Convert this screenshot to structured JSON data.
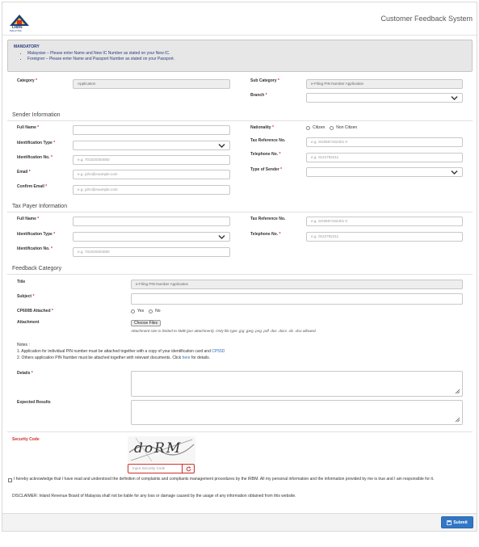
{
  "header": {
    "title": "Customer Feedback System",
    "logo_text": "LHDN",
    "logo_subtext": "MALAYSIA"
  },
  "mandatory": {
    "title": "MANDATORY",
    "items": [
      "Malaysian – Please enter Name and New IC Number as stated on your New IC.",
      "Foreigner – Please enter Name and Passport Number as stated on your Passport."
    ]
  },
  "top": {
    "category_label": "Category",
    "category_value": "Application",
    "subcategory_label": "Sub Category",
    "subcategory_value": "e-Filing PIN Number Application",
    "branch_label": "Branch"
  },
  "sender": {
    "section_title": "Sender Information",
    "full_name_label": "Full Name",
    "id_type_label": "Identification Type",
    "id_no_label": "Identification No.",
    "id_no_placeholder": "e.g. 701020304050",
    "email_label": "Email",
    "email_placeholder": "e.g. john@example.com",
    "confirm_email_label": "Confirm Email",
    "confirm_email_placeholder": "e.g. john@example.com",
    "nationality_label": "Nationality",
    "nationality_options": [
      "Citizen",
      "Non Citizen"
    ],
    "tax_ref_label": "Tax Reference No.",
    "tax_ref_placeholder": "e.g. SG0567162401 0",
    "telephone_label": "Telephone No.",
    "telephone_placeholder": "e.g. 0122782211",
    "sender_type_label": "Type of Sender"
  },
  "taxpayer": {
    "section_title": "Tax Payer Information",
    "full_name_label": "Full Name",
    "id_type_label": "Identification Type",
    "id_no_label": "Identification No.",
    "id_no_placeholder": "e.g. 701020304050",
    "tax_ref_label": "Tax Reference No.",
    "tax_ref_placeholder": "e.g. SG0567162401 0",
    "telephone_label": "Telephone No.",
    "telephone_placeholder": "e.g. 0122782211"
  },
  "feedback": {
    "section_title": "Feedback Category",
    "title_label": "Title",
    "title_value": "e-Filing PIN Number Application",
    "subject_label": "Subject",
    "cp600b_label": "CP600B Attached",
    "cp600b_options": [
      "Yes",
      "No"
    ],
    "attachment_label": "Attachment",
    "choose_files": "Choose Files",
    "attachment_note": "Attachment size is limited to 5MB (per attachment). Only file type .jpg .jpeg .png .pdf .doc .docx .xls .xlsx allowed.",
    "notes_title": "Notes :",
    "note1_prefix": "1. Application for individual PIN number must be attached together with a copy of your identification card and",
    "note1_link": "CP55D",
    "note2_prefix": "2. Others application PIN Number must be attached together with relevant documents. Click",
    "note2_link": "here",
    "note2_suffix": "for details.",
    "details_label": "Details",
    "expected_label": "Expected Results"
  },
  "security": {
    "label": "Security Code",
    "captcha_text": "doRM",
    "input_placeholder": "Input Security Code"
  },
  "acknowledge": "I hereby acknowledge that I have read and understood the definition of complaints and compliants management procedures by the IRBM. All my personal information and the information provided by me is true and I am responsible for it.",
  "disclaimer": "DISCLAIMER: Inland Revenue Board of Malaysia shall not be liable for any loss or damage caused by the usage of any information obtained from this website.",
  "submit_label": "Submit",
  "required_mark": "*"
}
